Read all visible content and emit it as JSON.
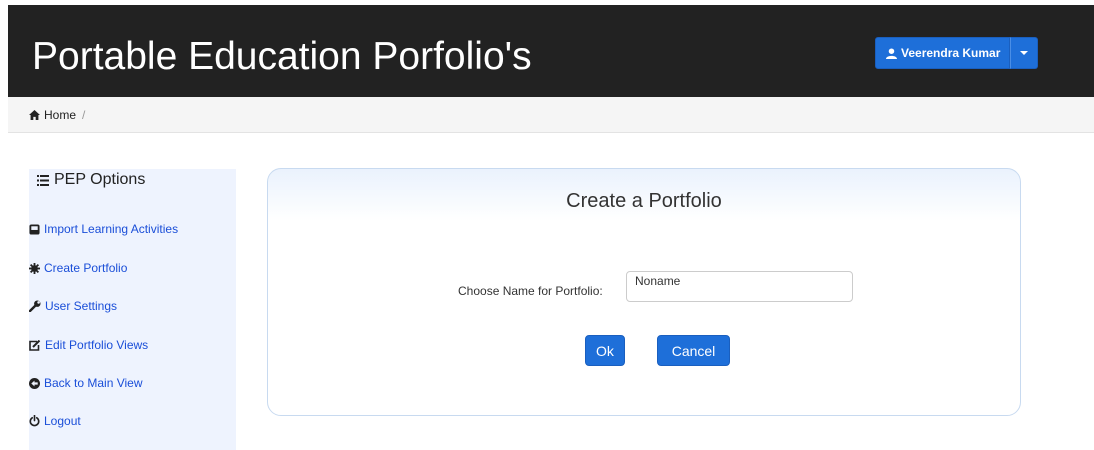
{
  "header": {
    "title": "Portable Education Porfolio's",
    "user_name": "Veerendra Kumar",
    "user_icon": "user-icon",
    "dropdown_icon": "caret-down-icon"
  },
  "breadcrumb": {
    "home_label": "Home",
    "separator": "/"
  },
  "sidebar": {
    "title": "PEP Options",
    "items": [
      {
        "label": "Import Learning Activities",
        "icon": "import-icon"
      },
      {
        "label": "Create Portfolio",
        "icon": "gear-icon"
      },
      {
        "label": "User Settings",
        "icon": "wrench-icon"
      },
      {
        "label": "Edit Portfolio Views",
        "icon": "edit-icon"
      },
      {
        "label": "Back to Main View",
        "icon": "back-icon"
      },
      {
        "label": "Logout",
        "icon": "power-icon"
      }
    ]
  },
  "form": {
    "title": "Create a Portfolio",
    "name_label": "Choose Name for Portfolio:",
    "name_value": "Noname",
    "ok_label": "Ok",
    "cancel_label": "Cancel"
  },
  "colors": {
    "navbar": "#222222",
    "accent": "#1e6fd9",
    "link": "#1a4ed8",
    "sidebar_bg": "#eef3fe"
  }
}
